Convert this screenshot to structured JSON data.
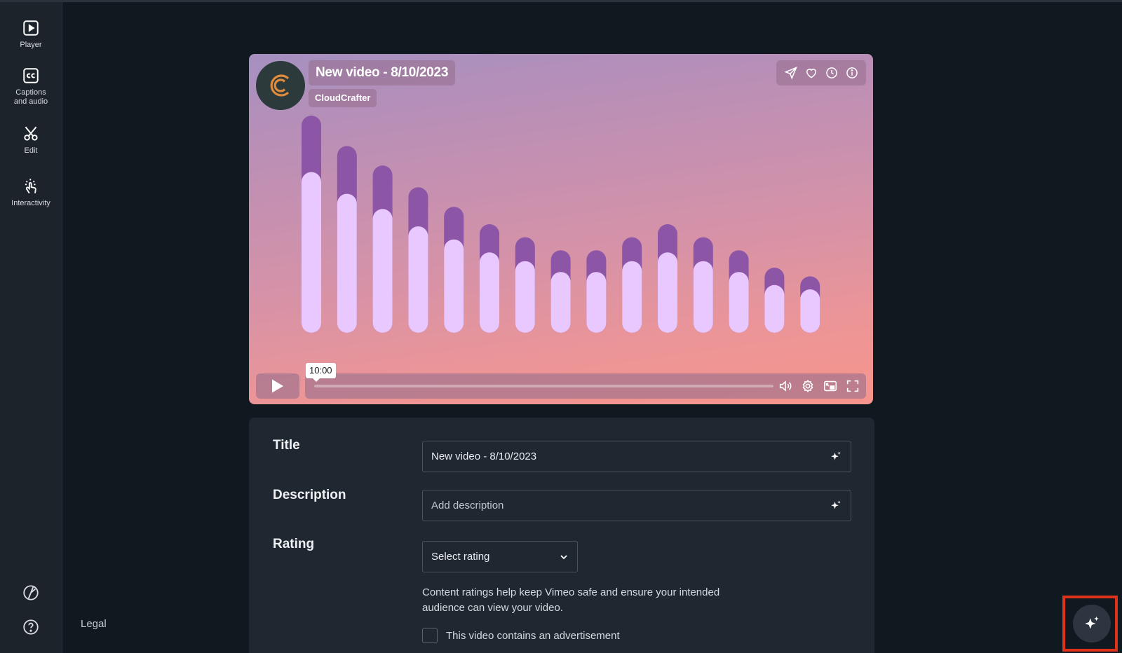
{
  "sidebar": {
    "items": [
      {
        "label": "Player",
        "icon": "play-square-icon"
      },
      {
        "label": "Captions and audio",
        "icon": "closed-captions-icon"
      },
      {
        "label": "Edit",
        "icon": "scissors-icon"
      },
      {
        "label": "Interactivity",
        "icon": "pointer-hand-icon"
      }
    ],
    "bottom_icons": [
      "palette-icon",
      "help-circle-icon"
    ]
  },
  "footer": {
    "legal_label": "Legal"
  },
  "player": {
    "title": "New video - 8/10/2023",
    "channel": "CloudCrafter",
    "time_tooltip": "10:00",
    "top_icons": [
      "share-icon",
      "like-icon",
      "watch-later-icon",
      "info-icon"
    ],
    "control_icons": [
      "volume-icon",
      "settings-icon",
      "picture-in-picture-icon",
      "fullscreen-icon"
    ],
    "audio_bars": [
      {
        "total": 1.0,
        "lower": 0.74
      },
      {
        "total": 0.86,
        "lower": 0.64
      },
      {
        "total": 0.77,
        "lower": 0.57
      },
      {
        "total": 0.67,
        "lower": 0.49
      },
      {
        "total": 0.58,
        "lower": 0.43
      },
      {
        "total": 0.5,
        "lower": 0.37
      },
      {
        "total": 0.44,
        "lower": 0.33
      },
      {
        "total": 0.38,
        "lower": 0.28
      },
      {
        "total": 0.38,
        "lower": 0.28
      },
      {
        "total": 0.44,
        "lower": 0.33
      },
      {
        "total": 0.5,
        "lower": 0.37
      },
      {
        "total": 0.44,
        "lower": 0.33
      },
      {
        "total": 0.38,
        "lower": 0.28
      },
      {
        "total": 0.3,
        "lower": 0.22
      },
      {
        "total": 0.26,
        "lower": 0.2
      }
    ],
    "colors": {
      "bar_top": "#8c55a6",
      "bar_bottom": "#e9c8ff"
    }
  },
  "form": {
    "title_label": "Title",
    "title_value": "New video - 8/10/2023",
    "description_label": "Description",
    "description_placeholder": "Add description",
    "rating_label": "Rating",
    "rating_value": "Select rating",
    "rating_help": "Content ratings help keep Vimeo safe and ensure your intended audience can view your video.",
    "ad_checkbox_label": "This video contains an advertisement",
    "ad_checked": false
  },
  "ai_button": {
    "icon": "sparkle-icon",
    "highlight_color": "#e0321a"
  }
}
